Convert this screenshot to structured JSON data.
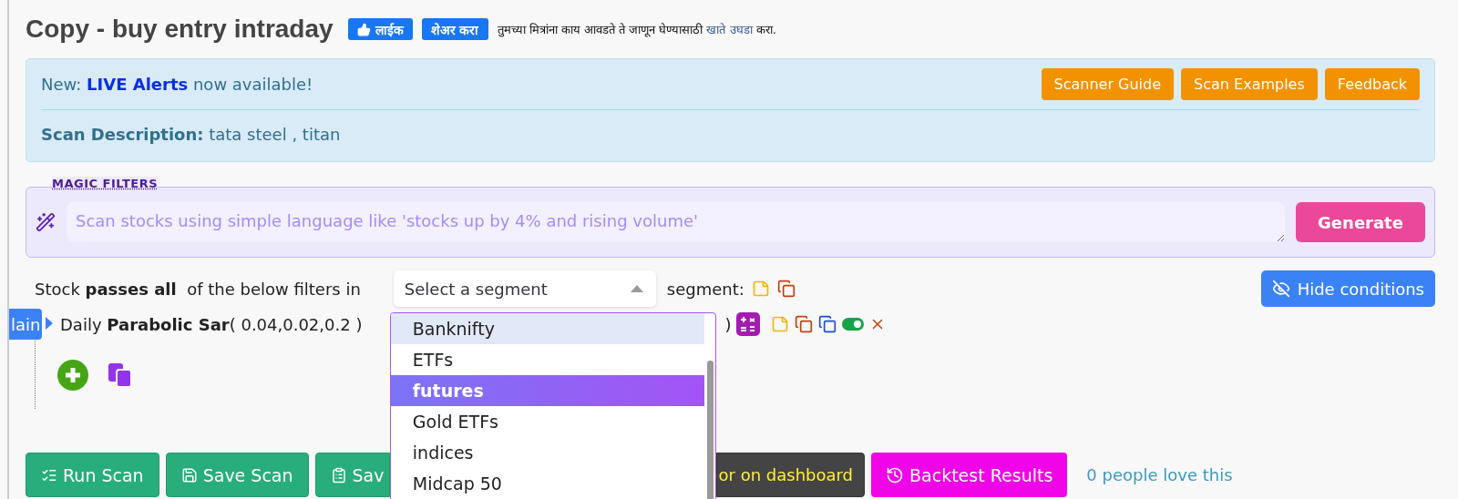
{
  "header": {
    "title": "Copy - buy entry intraday",
    "like_button": "लाईक",
    "share_button": "शेअर करा",
    "share_prompt": {
      "before": "तुमच्या मित्रांना काय आवडते ते जाणून घेण्यासाठी ",
      "link": "खाते उघडा",
      "after": " करा."
    }
  },
  "info": {
    "prefix": "New: ",
    "alert_link": "LIVE Alerts",
    "suffix": " now available!",
    "buttons": [
      "Scanner Guide",
      "Scan Examples",
      "Feedback"
    ],
    "description": "**Scan Description:** tata steel , titan"
  },
  "magic_filters": {
    "legend": "MAGIC FILTERS",
    "placeholder": "Scan stocks using simple language like 'stocks up by 4% and rising volume'",
    "button": "Generate"
  },
  "filter_line": {
    "text": "Stock **passes all**  of the below filters in",
    "segment_placeholder": "Select a segment",
    "segment_label": "segment:",
    "hide_button": "Hide conditions"
  },
  "tooltip": "lain",
  "condition": {
    "text": "Daily **Parabolic Sar**( 0.04,0.02,0.2 )",
    "closing": ")",
    "enabled": true
  },
  "dropdown": [
    {
      "label": "Banknifty",
      "selected": false,
      "current": true
    },
    {
      "label": "ETFs",
      "selected": false,
      "current": false
    },
    {
      "label": "futures",
      "selected": true,
      "current": false
    },
    {
      "label": "Gold ETFs",
      "selected": false,
      "current": false
    },
    {
      "label": "indices",
      "selected": false,
      "current": false
    },
    {
      "label": "Midcap 50",
      "selected": false,
      "current": false
    }
  ],
  "actions": [
    {
      "label": "Run Scan",
      "kind": "run"
    },
    {
      "label": "Save Scan",
      "kind": "save"
    },
    {
      "label": "Sav",
      "kind": "save-as"
    },
    {
      "label": "or on dashboard",
      "kind": "monitor"
    },
    {
      "label": "Backtest Results",
      "kind": "backtest"
    }
  ],
  "love_link": "0 people love this"
}
